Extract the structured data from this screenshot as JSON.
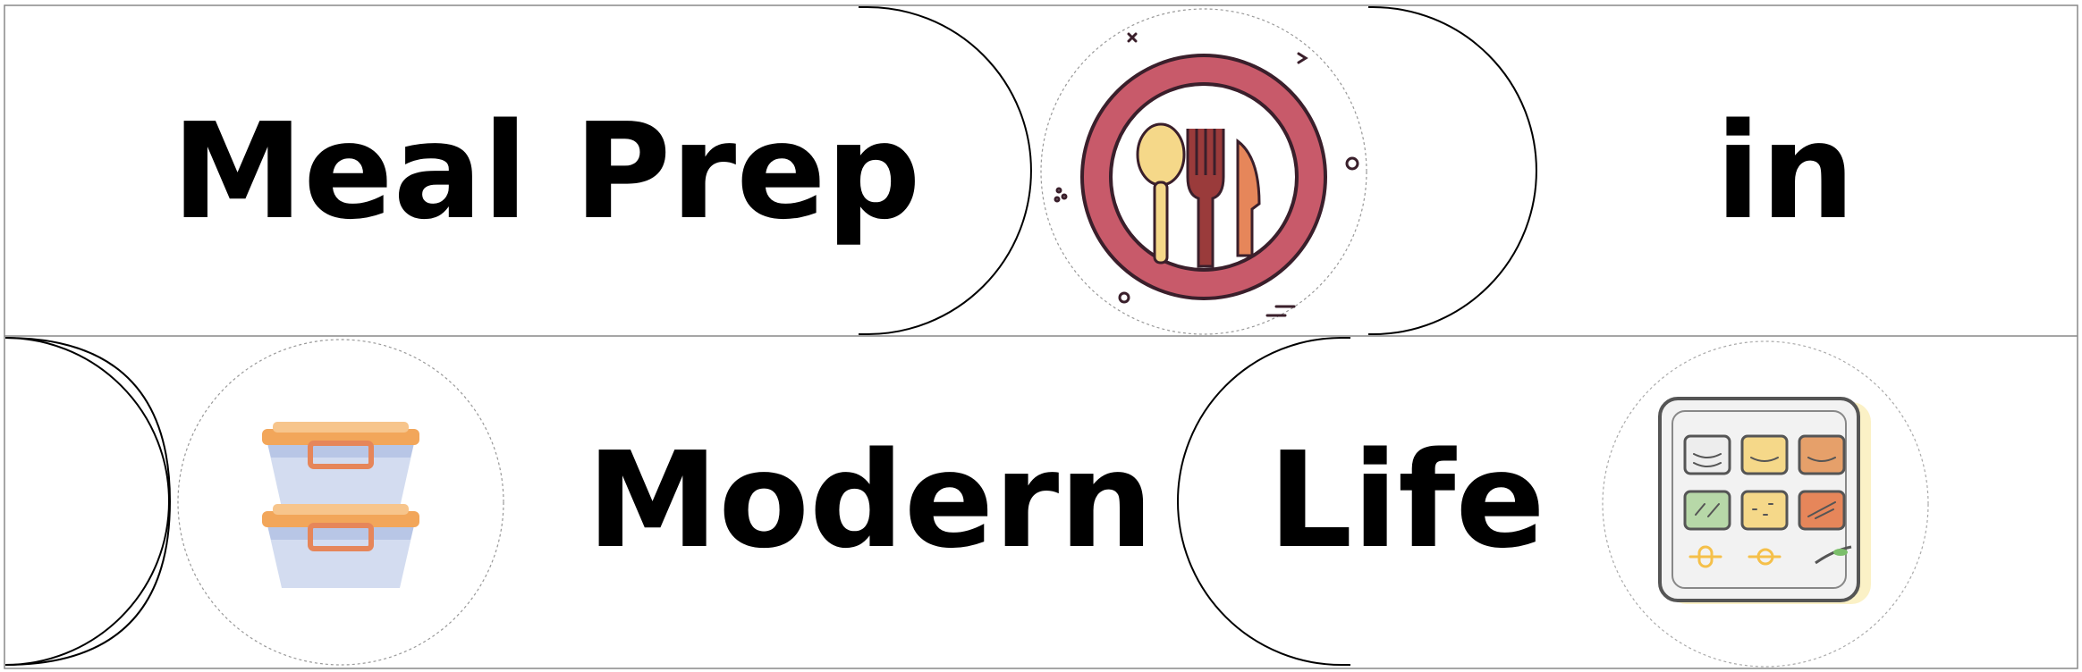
{
  "title_words": {
    "w1": "Meal Prep",
    "w2": "in",
    "w3": "Modern",
    "w4": "Life"
  },
  "icons": {
    "top": "plate-cutlery-icon",
    "bottom_left": "stacked-meal-containers-icon",
    "bottom_right": "meal-prep-tray-icon"
  },
  "colors": {
    "plate_ring": "#C85A6A",
    "spoon": "#F5D889",
    "fork": "#9A3B3B",
    "knife": "#E6865A",
    "container_lid": "#F2A65A",
    "container_body": "#D3DCF0",
    "tray_bg": "#F2F2F2"
  }
}
